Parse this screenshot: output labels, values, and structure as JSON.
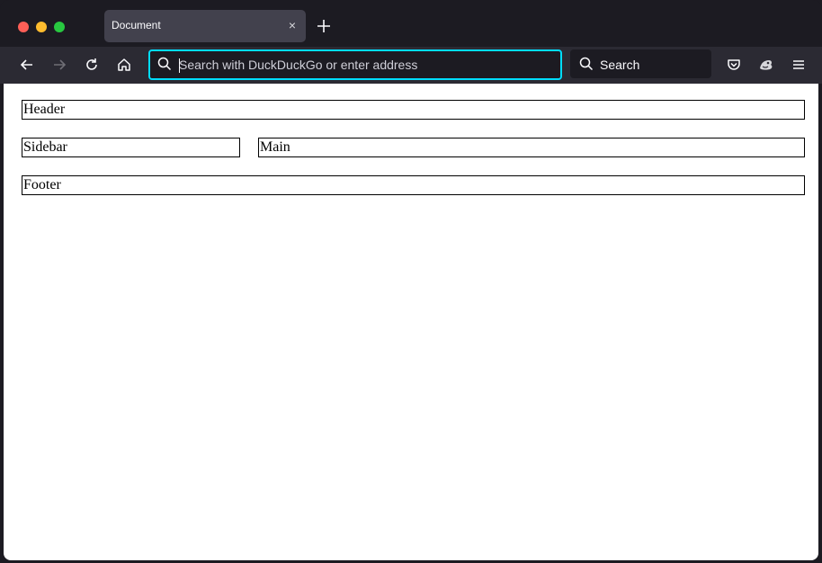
{
  "browser": {
    "tab": {
      "title": "Document",
      "close_glyph": "×"
    },
    "url_bar": {
      "placeholder": "Search with DuckDuckGo or enter address",
      "value": ""
    },
    "search_bar": {
      "label": "Search"
    },
    "colors": {
      "accent": "#00ddff",
      "toolbar": "#2b2a33",
      "tabstrip": "#1c1b22"
    }
  },
  "page": {
    "header": "Header",
    "sidebar": "Sidebar",
    "main": "Main",
    "footer": "Footer"
  }
}
